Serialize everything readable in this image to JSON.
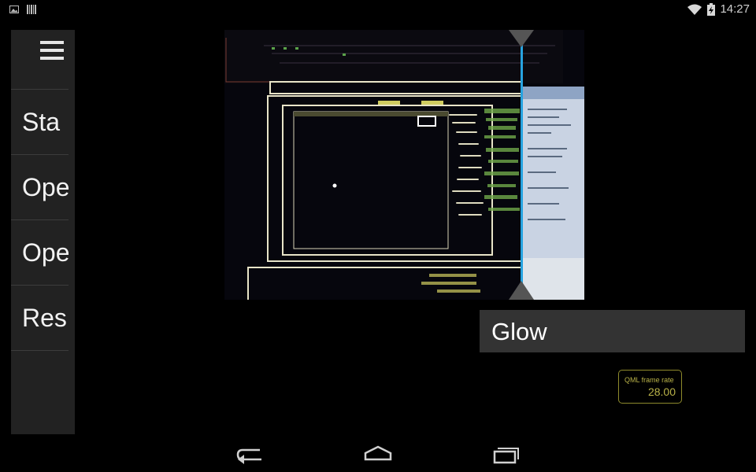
{
  "status_bar": {
    "left_icons": [
      "image-notification-icon",
      "barcode-notification-icon"
    ],
    "wifi_icon": "wifi-icon",
    "battery_icon": "battery-charging-icon",
    "time": "14:27"
  },
  "side_menu": {
    "menu_icon": "hamburger-menu-icon",
    "items": [
      {
        "label": "Sta"
      },
      {
        "label": "Ope"
      },
      {
        "label": "Ope"
      },
      {
        "label": "Res"
      }
    ]
  },
  "viewer": {
    "content": "camera-preview",
    "split_color": "#27a3e0"
  },
  "effect": {
    "name": "Glow"
  },
  "framerate": {
    "label": "QML frame rate",
    "value": "28.00",
    "color": "#b9b248"
  },
  "nav_bar": {
    "back_icon": "back-icon",
    "home_icon": "home-icon",
    "recents_icon": "recent-apps-icon"
  },
  "colors": {
    "background": "#000000",
    "panel": "#222222",
    "effect_box": "#333333",
    "accent": "#27a3e0"
  }
}
